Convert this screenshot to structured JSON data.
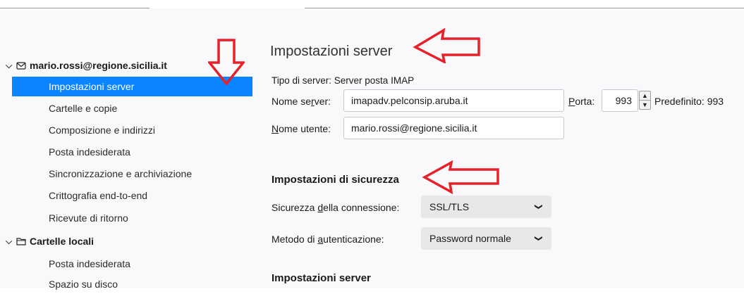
{
  "sidebar": {
    "account": {
      "chevron": "⌵",
      "icon": "envelope-icon",
      "label": "mario.rossi@regione.sicilia.it",
      "items": [
        {
          "label": "Impostazioni server",
          "selected": true
        },
        {
          "label": "Cartelle e copie",
          "selected": false
        },
        {
          "label": "Composizione e indirizzi",
          "selected": false
        },
        {
          "label": "Posta indesiderata",
          "selected": false
        },
        {
          "label": "Sincronizzazione e archiviazione",
          "selected": false
        },
        {
          "label": "Crittografia end-to-end",
          "selected": false
        },
        {
          "label": "Ricevute di ritorno",
          "selected": false
        }
      ]
    },
    "local": {
      "chevron": "⌵",
      "icon": "folder-icon",
      "label": "Cartelle locali",
      "items": [
        {
          "label": "Posta indesiderata"
        },
        {
          "label": "Spazio su disco"
        }
      ]
    }
  },
  "main": {
    "title": "Impostazioni server",
    "server_type": "Tipo di server: Server posta IMAP",
    "server_name": {
      "label_pre": "Nome se",
      "label_ul": "r",
      "label_post": "ver:",
      "value": "imapadv.pelconsip.aruba.it"
    },
    "port": {
      "label_ul": "P",
      "label_post": "orta:",
      "value": "993",
      "default_text": "Predefinito: 993"
    },
    "username": {
      "label_ul": "N",
      "label_post": "ome utente:",
      "value": "mario.rossi@regione.sicilia.it"
    },
    "security_heading": "Impostazioni di sicurezza",
    "connection_security": {
      "label_pre": "Sicurezza ",
      "label_ul": "d",
      "label_post": "ella connessione:",
      "value": "SSL/TLS"
    },
    "auth_method": {
      "label_pre": "Metodo di ",
      "label_ul": "a",
      "label_post": "utenticazione:",
      "value": "Password normale"
    },
    "server_heading": "Impostazioni server"
  },
  "annotations": {
    "arrow_color": "#e8202a",
    "icons": [
      "down-arrow-annotation-icon",
      "left-arrow-annotation-icon"
    ]
  }
}
